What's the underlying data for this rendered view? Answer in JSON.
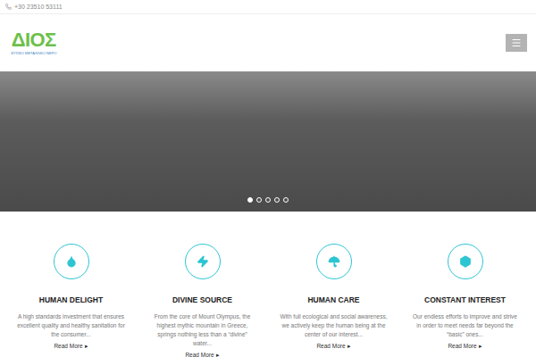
{
  "topbar": {
    "phone": "+30 23510 53111"
  },
  "logo": {
    "title": "ΔΙΟΣ",
    "subtitle": "ΦΥΣΙΚΟ ΜΕΤΑΛΛΙΚΟ ΝΕΡΟ"
  },
  "slider": {
    "slides": [
      {
        "selected": true
      },
      {
        "selected": false
      },
      {
        "selected": false
      },
      {
        "selected": false
      },
      {
        "selected": false
      }
    ]
  },
  "features": [
    {
      "kind": "drop",
      "title": "HUMAN DELIGHT",
      "text": "A high standards investment that ensures excellent quality and healthy sanitation for the consumer...",
      "link": "Read More",
      "arrow": "▸"
    },
    {
      "kind": "bolt",
      "title": "DIVINE SOURCE",
      "text": "From the core of Mount Olympus, the highest mythic mountain in Greece, springs nothing less than a “divine” water...",
      "link": "Read More",
      "arrow": "▸"
    },
    {
      "kind": "umbrella",
      "title": "HUMAN CARE",
      "text": "With full ecological and social awareness, we actively keep the human being at the center of our interest...",
      "link": "Read More",
      "arrow": "▸"
    },
    {
      "kind": "cube",
      "title": "CONSTANT INTEREST",
      "text": "Our endless efforts to improve and strive in order to meet needs far beyond the “basic” ones...",
      "link": "Read More",
      "arrow": "▸"
    }
  ]
}
